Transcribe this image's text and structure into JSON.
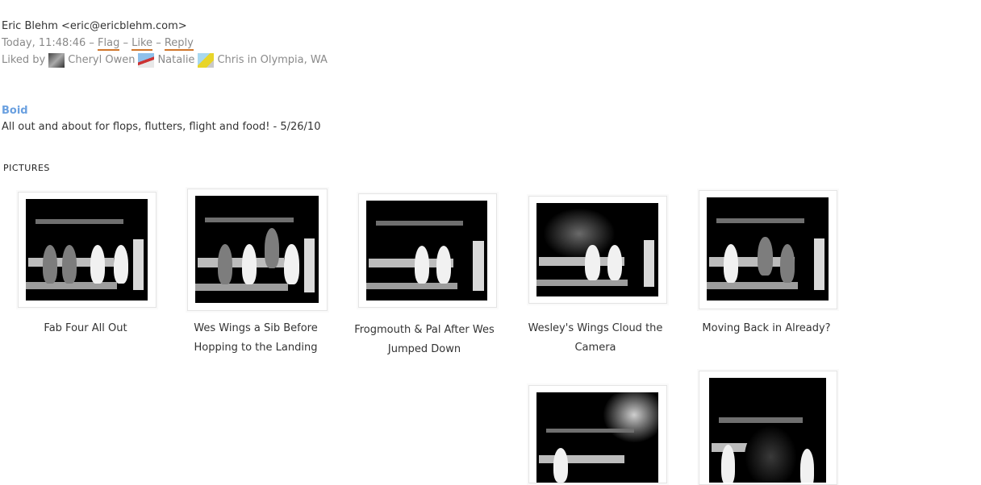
{
  "header": {
    "from": "Eric Blehm <eric@ericblehm.com>",
    "time": "Today, 11:48:46",
    "sep": "–",
    "flag": "Flag",
    "like": "Like",
    "reply": "Reply",
    "liked_by_label": "Liked by",
    "likers": [
      "Cheryl Owen",
      "Natalie",
      "Chris in Olympia, WA"
    ]
  },
  "post": {
    "title": "Boid",
    "body": "All out and about for flops, flutters, flight and food! - 5/26/10"
  },
  "pictures": {
    "section_label": "PICTURES",
    "items": [
      {
        "caption": "Fab Four All Out"
      },
      {
        "caption": "Wes Wings a Sib Before Hopping to the Landing"
      },
      {
        "caption": "Frogmouth & Pal After Wes Jumped Down"
      },
      {
        "caption": "Wesley's Wings Cloud the Camera"
      },
      {
        "caption": "Moving Back in Already?"
      },
      {
        "caption": ""
      },
      {
        "caption": ""
      }
    ]
  },
  "colors": {
    "link_accent": "#d0762a",
    "title_blue": "#6aa0e0"
  }
}
